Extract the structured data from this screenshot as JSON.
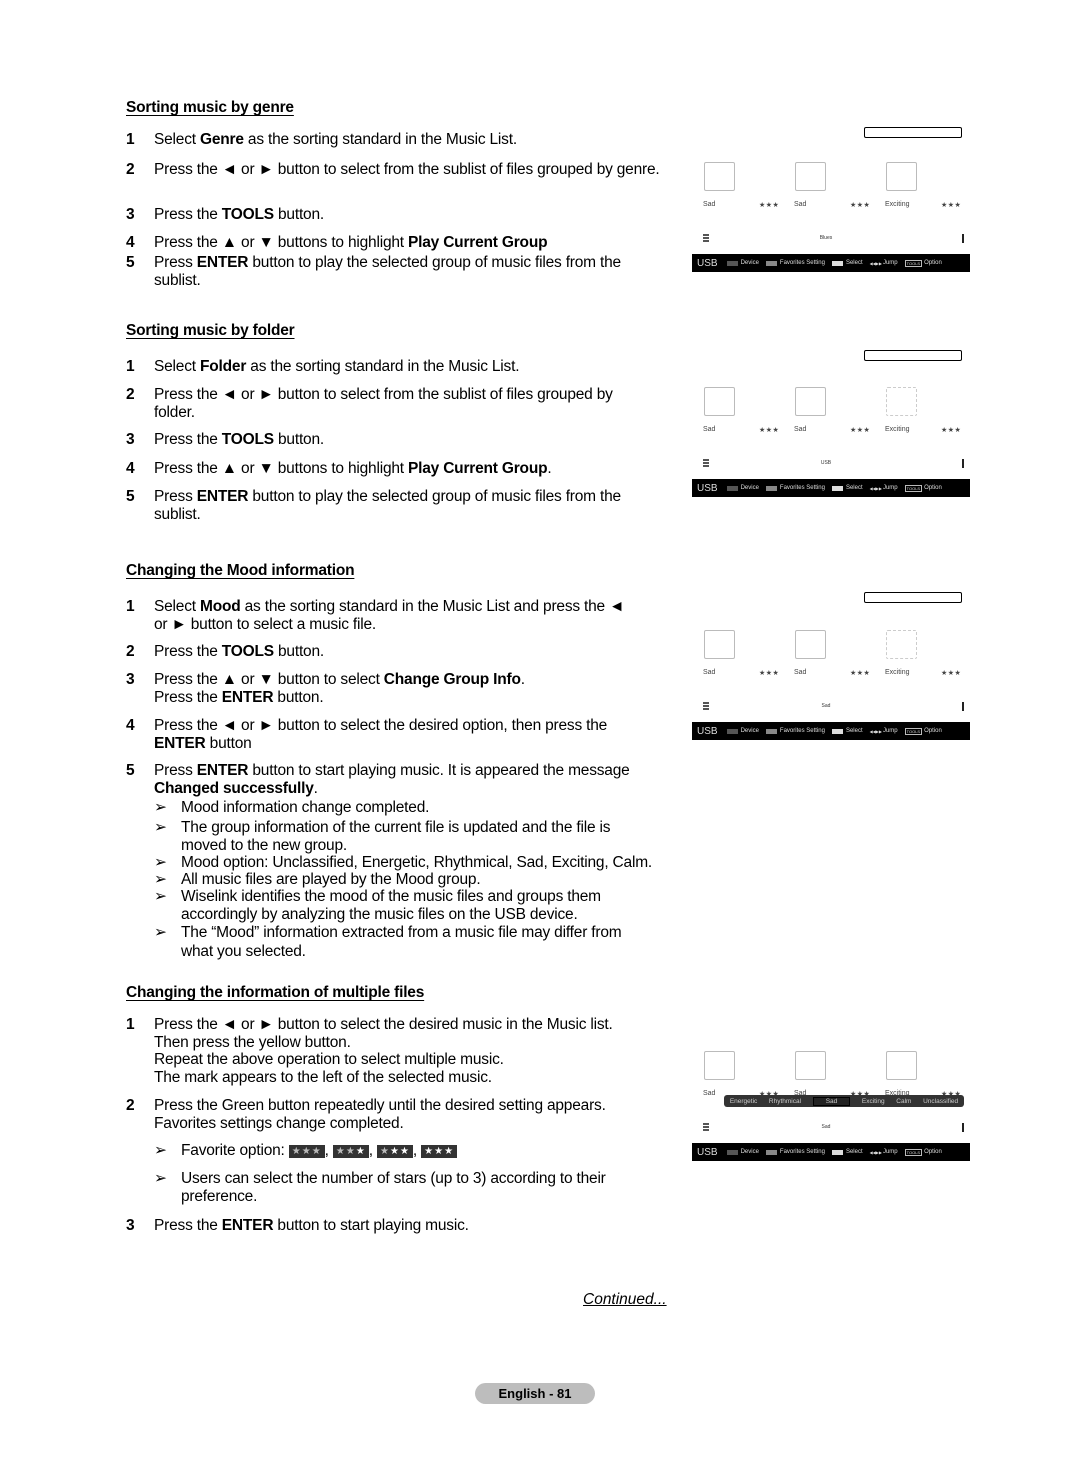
{
  "sections": {
    "genre": {
      "heading": "Sorting music by genre",
      "steps": [
        {
          "num": "1",
          "pre": "Select ",
          "bold": "Genre",
          "post": " as the sorting standard in the Music List."
        },
        {
          "num": "2",
          "text": "Press the ◄ or ► button to select from the sublist of files grouped by genre."
        },
        {
          "num": "3",
          "pre": "Press the ",
          "bold": "TOOLS",
          "post": " button."
        },
        {
          "num": "4",
          "pre": "Press the ▲ or ▼ buttons  to highlight ",
          "bold": "Play Current Group",
          "post": ""
        },
        {
          "num": "5",
          "pre": "Press ",
          "bold": "ENTER",
          "post": " button to play the selected group of music files from the sublist."
        }
      ]
    },
    "folder": {
      "heading": "Sorting music by folder",
      "steps": [
        {
          "num": "1",
          "pre": "Select ",
          "bold": "Folder",
          "post": " as the sorting standard in the Music List."
        },
        {
          "num": "2",
          "text": "Press the ◄ or ► button to select from the sublist of files grouped by folder."
        },
        {
          "num": "3",
          "pre": "Press the ",
          "bold": "TOOLS",
          "post": " button."
        },
        {
          "num": "4",
          "pre": "Press the ▲ or ▼ buttons  to highlight ",
          "bold": "Play Current Group",
          "post": "."
        },
        {
          "num": "5",
          "pre": "Press ",
          "bold": "ENTER",
          "post": " button to play the selected group of music files from the sublist."
        }
      ]
    },
    "mood": {
      "heading": "Changing the Mood information",
      "steps": [
        {
          "num": "1",
          "pre": "Select ",
          "bold": "Mood",
          "post": " as the sorting standard in the Music List and press the ◄ or ► button to select a music file."
        },
        {
          "num": "2",
          "pre": "Press the ",
          "bold": "TOOLS",
          "post": " button."
        },
        {
          "num": "3",
          "pre": "Press the ▲ or ▼ button to select ",
          "bold": "Change Group Info",
          "post": ".",
          "line2_pre": "Press the ",
          "line2_bold": "ENTER",
          "line2_post": " button."
        },
        {
          "num": "4",
          "pre": "Press the ◄ or ► button to select the desired option, then press the ",
          "bold": "ENTER",
          "post": " button"
        },
        {
          "num": "5",
          "pre": "Press ",
          "bold": "ENTER",
          "post": " button to start playing music. It is appeared the message ",
          "bold2": "Changed successfully",
          "post2": "."
        }
      ],
      "notes": [
        "Mood information change completed.",
        "The group information of the current file is updated and the file is moved to the new group.",
        "Mood option: Unclassified, Energetic, Rhythmical, Sad, Exciting, Calm.",
        "All music files are played by the Mood group.",
        "Wiselink identifies the mood of the music files and groups them accordingly by analyzing the music files on the USB device.",
        "The “Mood” information extracted from a music file may differ from what you selected."
      ]
    },
    "multiple": {
      "heading": "Changing the information of multiple files",
      "steps": [
        {
          "num": "1",
          "lines": [
            "Press the ◄ or ► button to select the desired music in the Music list.",
            "Then press the yellow button.",
            "Repeat the above operation to select multiple music.",
            "The mark appears to the left of the selected music."
          ]
        },
        {
          "num": "2",
          "lines": [
            "Press the Green button repeatedly until the desired setting appears.",
            "Favorites settings change completed."
          ]
        },
        {
          "num": "3",
          "pre": "Press the ",
          "bold": "ENTER",
          "post": " button to start playing music."
        }
      ],
      "notes": {
        "favorite_label": "Favorite option: ",
        "favorite_levels": [
          0,
          1,
          2,
          3
        ],
        "users_note": "Users can select the number of stars (up to 3) according to their preference."
      }
    }
  },
  "arrow_glyph": "➢",
  "star_glyph": "★",
  "screens": {
    "cards": [
      {
        "mood": "Sad",
        "stars": "★★★"
      },
      {
        "mood": "Sad",
        "stars": "★★★"
      },
      {
        "mood": "Exciting",
        "stars": "★★★"
      }
    ],
    "groups": [
      "Blues",
      "USB",
      "Sad",
      "Sad"
    ],
    "bottom_bar": {
      "source": "USB",
      "device": "Device",
      "favorites": "Favorites Setting",
      "select": "Select",
      "jump_icon": "◀◀▶▶",
      "jump": "Jump",
      "tools": "TOOLS",
      "option": "Option"
    },
    "mood_popup": {
      "options": [
        "Energetic",
        "Rhythmical",
        "Sad",
        "Exciting",
        "Calm",
        "Unclassified"
      ],
      "selected": "Sad"
    }
  },
  "footer": {
    "continued": "Continued...",
    "page": "English - 81"
  }
}
